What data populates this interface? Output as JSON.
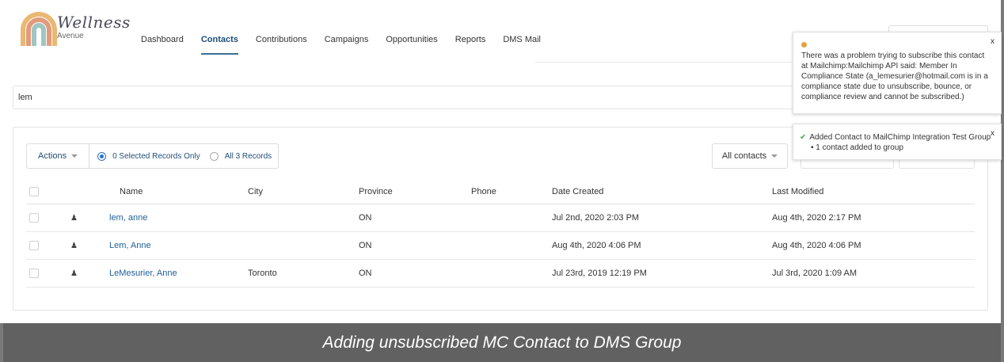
{
  "brand": {
    "name": "Wellness",
    "tagline": "Avenue"
  },
  "nav": [
    {
      "label": "Dashboard",
      "active": false
    },
    {
      "label": "Contacts",
      "active": true
    },
    {
      "label": "Contributions",
      "active": false
    },
    {
      "label": "Campaigns",
      "active": false
    },
    {
      "label": "Opportunities",
      "active": false
    },
    {
      "label": "Reports",
      "active": false
    },
    {
      "label": "DMS Mail",
      "active": false
    }
  ],
  "search": {
    "value": "lem"
  },
  "toolbar": {
    "actions_label": "Actions",
    "selected_only_label": "0 Selected Records Only",
    "all_records_label": "All 3 Records",
    "filter_label": "All contacts"
  },
  "table": {
    "headers": [
      "Name",
      "City",
      "Province",
      "Phone",
      "Date Created",
      "Last Modified"
    ],
    "rows": [
      {
        "name": "lem, anne",
        "city": "",
        "province": "ON",
        "phone": "",
        "created": "Jul 2nd, 2020 2:03 PM",
        "modified": "Aug 4th, 2020 2:17 PM"
      },
      {
        "name": "Lem, Anne",
        "city": "",
        "province": "ON",
        "phone": "",
        "created": "Aug 4th, 2020 4:06 PM",
        "modified": "Aug 4th, 2020 4:06 PM"
      },
      {
        "name": "LeMesurier, Anne",
        "city": "Toronto",
        "province": "ON",
        "phone": "",
        "created": "Jul 23rd, 2019 12:19 PM",
        "modified": "Jul 3rd, 2020 1:09 AM"
      }
    ]
  },
  "toasts": {
    "error": {
      "message": "There was a problem trying to subscribe this contact at Mailchimp:Mailchimp API said: Member In Compliance State (a_lemesurier@hotmail.com is in a compliance state due to unsubscribe, bounce, or compliance review and cannot be subscribed.)",
      "close": "x",
      "icon_color": "#e8a13a"
    },
    "success": {
      "title": "Added Contact to MailChimp Integration Test Group",
      "detail": "1 contact added to group",
      "close": "x",
      "icon_color": "#4caf50"
    }
  },
  "caption": "Adding unsubscribed MC Contact to DMS Group",
  "colors": {
    "accent": "#1f4f7a",
    "link": "#1f5f99",
    "caption_bg": "#616161"
  }
}
